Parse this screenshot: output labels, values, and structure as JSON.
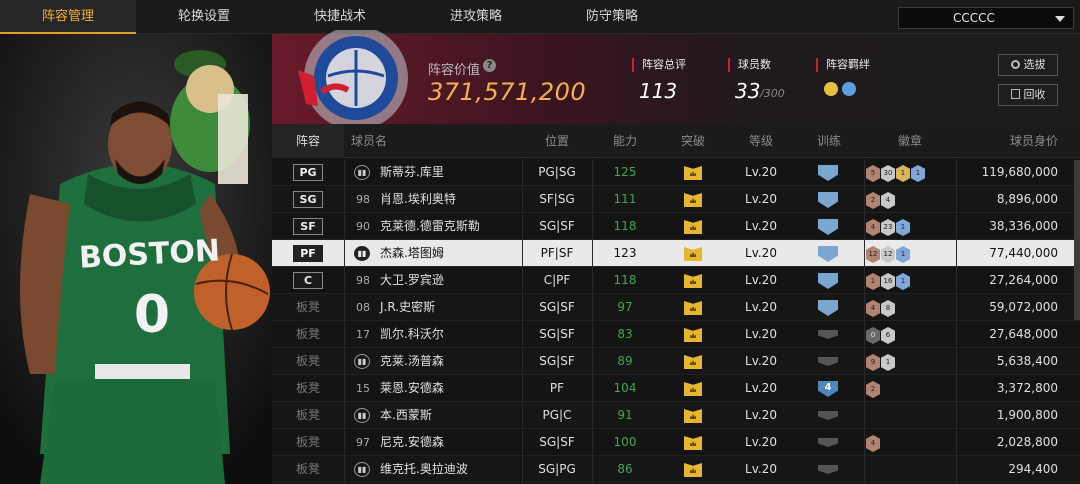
{
  "tabs": [
    {
      "label": "阵容管理",
      "active": true
    },
    {
      "label": "轮换设置"
    },
    {
      "label": "快捷战术"
    },
    {
      "label": "进攻策略"
    },
    {
      "label": "防守策略"
    }
  ],
  "team_select": {
    "value": "CCCCC"
  },
  "header": {
    "value_label": "阵容价值",
    "value": "371,571,200",
    "stats": [
      {
        "label": "阵容总评",
        "value": "113"
      },
      {
        "label": "球员数",
        "value": "33",
        "suffix": "/300"
      },
      {
        "label": "阵容羁绊"
      }
    ],
    "buttons": {
      "select": "选拔",
      "recycle": "回收"
    }
  },
  "columns": [
    "阵容",
    "球员名",
    "位置",
    "能力",
    "突破",
    "等级",
    "训练",
    "徽章",
    "球员身价"
  ],
  "rows": [
    {
      "slot": "PG",
      "num": "",
      "name": "斯蒂芬.库里",
      "pos": "PG|SG",
      "ability": "125",
      "level": "Lv.20",
      "train": "b",
      "badges": [
        [
          "br",
          "5"
        ],
        [
          "si",
          "30"
        ],
        [
          "go",
          "1"
        ],
        [
          "pl",
          "1"
        ]
      ],
      "value": "119,680,000"
    },
    {
      "slot": "SG",
      "num": "98",
      "name": "肖恩.埃利奥特",
      "pos": "SF|SG",
      "ability": "111",
      "level": "Lv.20",
      "train": "b",
      "badges": [
        [
          "br",
          "2"
        ],
        [
          "si",
          "4"
        ]
      ],
      "value": "8,896,000"
    },
    {
      "slot": "SF",
      "num": "90",
      "name": "克莱德.德雷克斯勒",
      "pos": "SG|SF",
      "ability": "118",
      "level": "Lv.20",
      "train": "b",
      "badges": [
        [
          "br",
          "4"
        ],
        [
          "si",
          "23"
        ],
        [
          "pl",
          "1"
        ]
      ],
      "value": "38,336,000"
    },
    {
      "slot": "PF",
      "num": "",
      "name": "杰森.塔图姆",
      "pos": "PF|SF",
      "ability": "123",
      "level": "Lv.20",
      "train": "b",
      "badges": [
        [
          "br",
          "12"
        ],
        [
          "si",
          "12"
        ],
        [
          "pl",
          "1"
        ]
      ],
      "value": "77,440,000",
      "selected": true
    },
    {
      "slot": "C",
      "num": "98",
      "name": "大卫.罗宾逊",
      "pos": "C|PF",
      "ability": "118",
      "level": "Lv.20",
      "train": "b",
      "badges": [
        [
          "br",
          "1"
        ],
        [
          "si",
          "16"
        ],
        [
          "pl",
          "1"
        ]
      ],
      "value": "27,264,000"
    },
    {
      "slot": "板凳",
      "num": "08",
      "name": "J.R.史密斯",
      "pos": "SG|SF",
      "ability": "97",
      "level": "Lv.20",
      "train": "b",
      "badges": [
        [
          "br",
          "4"
        ],
        [
          "si",
          "8"
        ]
      ],
      "value": "59,072,000"
    },
    {
      "slot": "板凳",
      "num": "17",
      "name": "凯尔.科沃尔",
      "pos": "SG|SF",
      "ability": "83",
      "level": "Lv.20",
      "train": "g",
      "badges": [
        [
          "dk",
          "0"
        ],
        [
          "si",
          "6"
        ]
      ],
      "value": "27,648,000"
    },
    {
      "slot": "板凳",
      "num": "",
      "name": "克莱.汤普森",
      "pos": "SG|SF",
      "ability": "89",
      "level": "Lv.20",
      "train": "g",
      "badges": [
        [
          "br",
          "9"
        ],
        [
          "si",
          "1"
        ]
      ],
      "value": "5,638,400"
    },
    {
      "slot": "板凳",
      "num": "15",
      "name": "莱恩.安德森",
      "pos": "PF",
      "ability": "104",
      "level": "Lv.20",
      "train": "n",
      "train_num": "4",
      "badges": [
        [
          "br",
          "2"
        ]
      ],
      "value": "3,372,800"
    },
    {
      "slot": "板凳",
      "num": "",
      "name": "本.西蒙斯",
      "pos": "PG|C",
      "ability": "91",
      "level": "Lv.20",
      "train": "g",
      "badges": [],
      "value": "1,900,800"
    },
    {
      "slot": "板凳",
      "num": "97",
      "name": "尼克.安德森",
      "pos": "SG|SF",
      "ability": "100",
      "level": "Lv.20",
      "train": "g",
      "badges": [
        [
          "br",
          "4"
        ]
      ],
      "value": "2,028,800"
    },
    {
      "slot": "板凳",
      "num": "",
      "name": "维克托.奥拉迪波",
      "pos": "SG|PG",
      "ability": "86",
      "level": "Lv.20",
      "train": "g",
      "badges": [],
      "value": "294,400"
    }
  ],
  "colors": {
    "accent": "#e0a020",
    "ability": "#3ea84a",
    "team_red": "#d02030"
  }
}
